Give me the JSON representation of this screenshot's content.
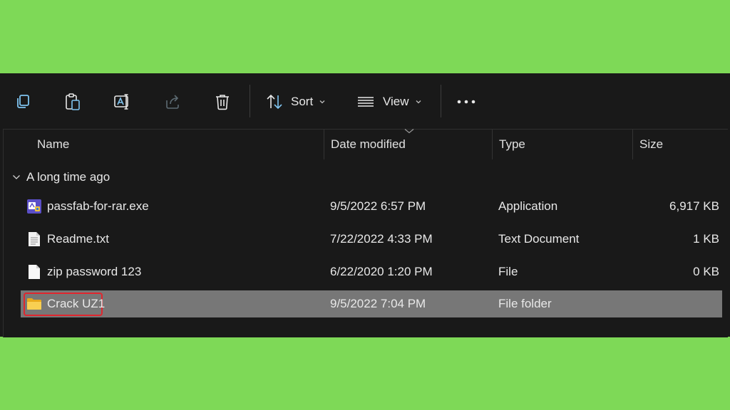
{
  "toolbar": {
    "sort_label": "Sort",
    "view_label": "View",
    "icons": [
      "copy-icon",
      "paste-icon",
      "rename-icon",
      "share-icon",
      "delete-icon",
      "sort-icon",
      "view-icon",
      "more-icon"
    ]
  },
  "columns": {
    "name": "Name",
    "date": "Date modified",
    "type": "Type",
    "size": "Size"
  },
  "group": {
    "label": "A long time ago"
  },
  "files": [
    {
      "name": "passfab-for-rar.exe",
      "date": "9/5/2022 6:57 PM",
      "type": "Application",
      "size": "6,917 KB",
      "icon": "application-icon"
    },
    {
      "name": "Readme.txt",
      "date": "7/22/2022 4:33 PM",
      "type": "Text Document",
      "size": "1 KB",
      "icon": "text-document-icon"
    },
    {
      "name": "zip password 123",
      "date": "6/22/2020 1:20 PM",
      "type": "File",
      "size": "0 KB",
      "icon": "file-icon"
    },
    {
      "name": "Crack UZ1",
      "date": "9/5/2022 7:04 PM",
      "type": "File folder",
      "size": "",
      "icon": "folder-icon",
      "selected": true
    }
  ],
  "colors": {
    "background": "#7ed957",
    "window": "#191919",
    "selection": "#777777",
    "highlight_border": "#e0262e"
  }
}
